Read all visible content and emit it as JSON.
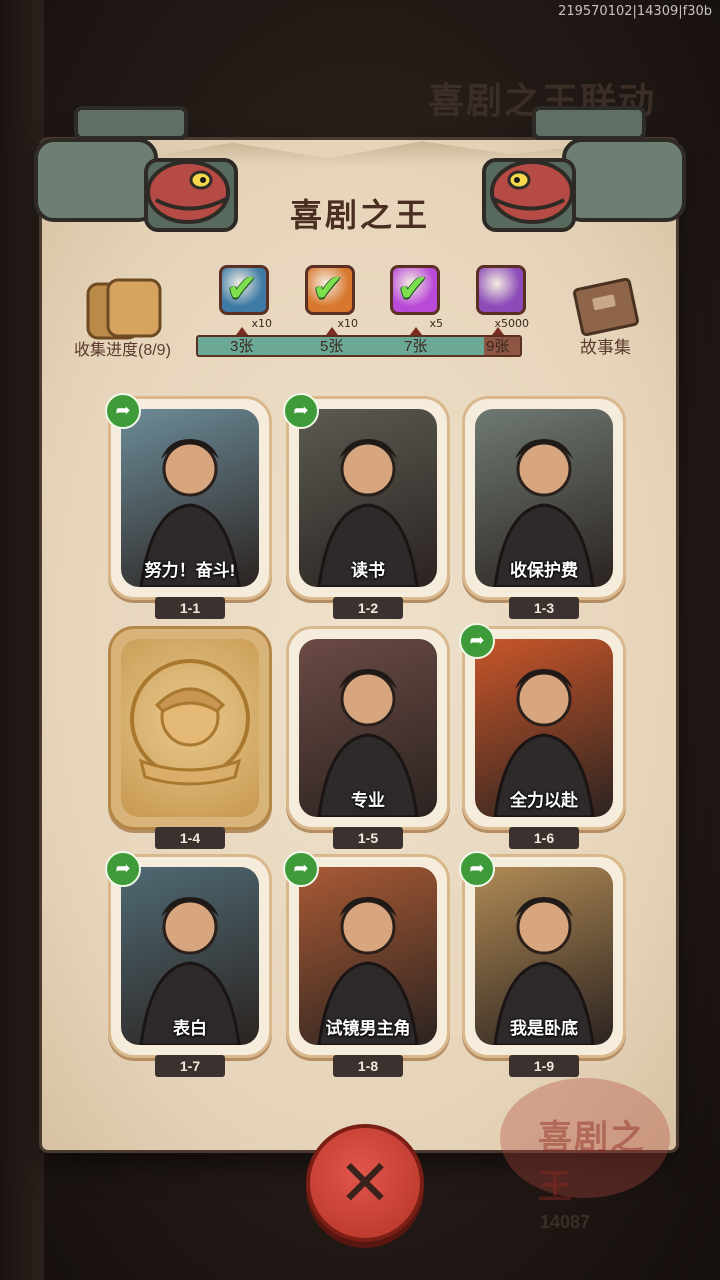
{
  "build_id": "219570102|14309|f30b",
  "background": {
    "title": "喜剧之王联动",
    "counter": "14087"
  },
  "panel": {
    "title": "喜剧之王",
    "seal_text": "喜剧之王"
  },
  "progress": {
    "label": "收集进度(8/9)",
    "collected": 8,
    "total": 9,
    "milestones": [
      {
        "label": "3张",
        "qty": "x10",
        "icon": "blue-ticket-icon",
        "claimed": true,
        "color": "#3d7ba6"
      },
      {
        "label": "5张",
        "qty": "x10",
        "icon": "orange-ticket-icon",
        "claimed": true,
        "color": "#d8772e"
      },
      {
        "label": "7张",
        "qty": "x5",
        "icon": "rainbow-egg-icon",
        "claimed": true,
        "color": "#b94ad8"
      },
      {
        "label": "9张",
        "qty": "x5000",
        "icon": "crystal-icon",
        "claimed": false,
        "color": "#8c4bb8"
      }
    ]
  },
  "story": {
    "label": "故事集"
  },
  "cards": [
    {
      "num": "1-1",
      "caption": "努力！奋斗!",
      "shared": true,
      "locked": false,
      "bg": "#6c8c99"
    },
    {
      "num": "1-2",
      "caption": "读书",
      "shared": true,
      "locked": false,
      "bg": "#5b5a52"
    },
    {
      "num": "1-3",
      "caption": "收保护费",
      "shared": false,
      "locked": false,
      "bg": "#6f7a72"
    },
    {
      "num": "1-4",
      "caption": "",
      "shared": false,
      "locked": true,
      "bg": "#d3a862"
    },
    {
      "num": "1-5",
      "caption": "专业",
      "shared": false,
      "locked": false,
      "bg": "#6b4a44"
    },
    {
      "num": "1-6",
      "caption": "全力以赴",
      "shared": true,
      "locked": false,
      "bg": "#c9562a"
    },
    {
      "num": "1-7",
      "caption": "表白",
      "shared": true,
      "locked": false,
      "bg": "#4f6a74"
    },
    {
      "num": "1-8",
      "caption": "试镜男主角",
      "shared": true,
      "locked": false,
      "bg": "#a95a35"
    },
    {
      "num": "1-9",
      "caption": "我是卧底",
      "shared": true,
      "locked": false,
      "bg": "#b08a55"
    }
  ],
  "close_button": {
    "icon": "close-x-icon"
  }
}
